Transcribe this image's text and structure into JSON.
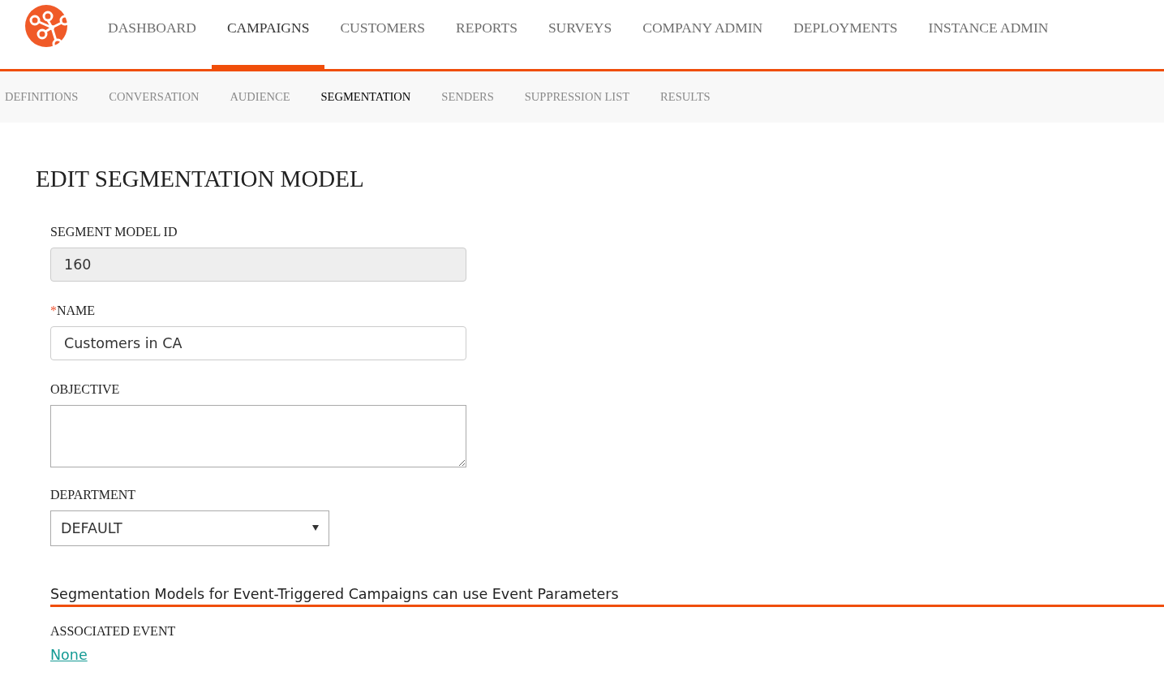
{
  "top_nav": [
    {
      "label": "DASHBOARD",
      "selected": false
    },
    {
      "label": "CAMPAIGNS",
      "selected": true
    },
    {
      "label": "CUSTOMERS",
      "selected": false
    },
    {
      "label": "REPORTS",
      "selected": false
    },
    {
      "label": "SURVEYS",
      "selected": false
    },
    {
      "label": "COMPANY ADMIN",
      "selected": false
    },
    {
      "label": "DEPLOYMENTS",
      "selected": false
    },
    {
      "label": "INSTANCE ADMIN",
      "selected": false
    }
  ],
  "sub_nav": [
    {
      "label": "DEFINITIONS",
      "selected": false
    },
    {
      "label": "CONVERSATION",
      "selected": false
    },
    {
      "label": "AUDIENCE",
      "selected": false
    },
    {
      "label": "SEGMENTATION",
      "selected": true
    },
    {
      "label": "SENDERS",
      "selected": false
    },
    {
      "label": "SUPPRESSION LIST",
      "selected": false
    },
    {
      "label": "RESULTS",
      "selected": false
    }
  ],
  "page_title": "EDIT SEGMENTATION MODEL",
  "fields": [
    {
      "kind": "input",
      "label": "SEGMENT MODEL ID",
      "value": "160",
      "disabled": true
    },
    {
      "kind": "input",
      "label": "NAME",
      "required_mark": "*",
      "value": "Customers in CA",
      "disabled": false
    },
    {
      "kind": "textarea",
      "label": "OBJECTIVE"
    },
    {
      "kind": "select",
      "label": "DEPARTMENT",
      "value": "DEFAULT"
    }
  ],
  "section_heading": "Segmentation Models for Event-Triggered Campaigns can use Event Parameters",
  "associated_event": {
    "label": "ASSOCIATED EVENT",
    "link": "None"
  }
}
